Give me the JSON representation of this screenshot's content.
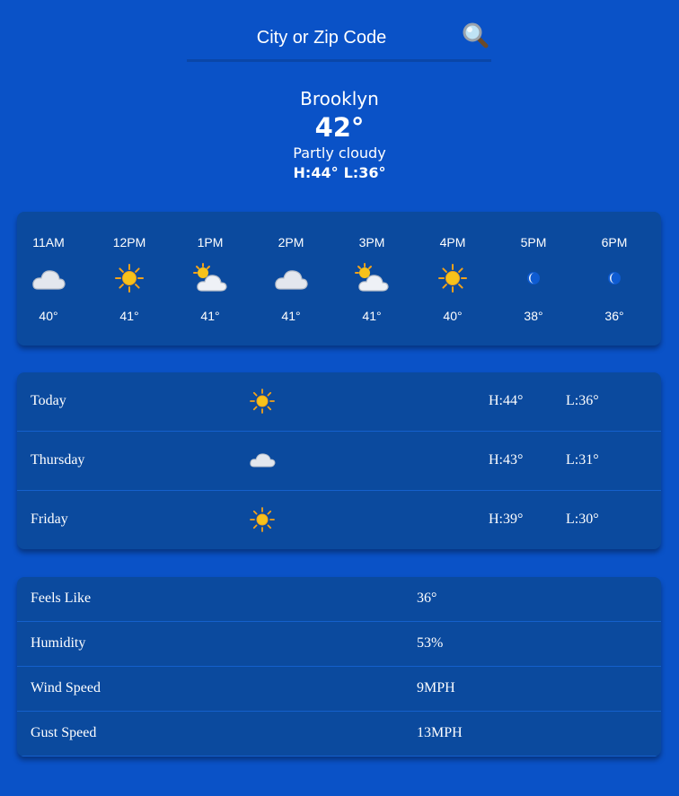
{
  "search": {
    "placeholder": "City or Zip Code",
    "icon": "magnifying-glass-icon"
  },
  "current": {
    "city": "Brooklyn",
    "temp": "42°",
    "condition": "Partly cloudy",
    "high": "H:44°",
    "low": "L:36°"
  },
  "hourly": [
    {
      "time": "11AM",
      "icon": "cloud-icon",
      "temp": "40°"
    },
    {
      "time": "12PM",
      "icon": "sun-icon",
      "temp": "41°"
    },
    {
      "time": "1PM",
      "icon": "sun-behind-cloud-icon",
      "temp": "41°"
    },
    {
      "time": "2PM",
      "icon": "cloud-icon",
      "temp": "41°"
    },
    {
      "time": "3PM",
      "icon": "sun-behind-cloud-icon",
      "temp": "41°"
    },
    {
      "time": "4PM",
      "icon": "sun-icon",
      "temp": "40°"
    },
    {
      "time": "5PM",
      "icon": "moon-icon",
      "temp": "38°"
    },
    {
      "time": "6PM",
      "icon": "moon-icon",
      "temp": "36°"
    }
  ],
  "daily": [
    {
      "day": "Today",
      "icon": "sun-icon",
      "high": "H:44°",
      "low": "L:36°"
    },
    {
      "day": "Thursday",
      "icon": "cloud-icon",
      "high": "H:43°",
      "low": "L:31°"
    },
    {
      "day": "Friday",
      "icon": "sun-icon",
      "high": "H:39°",
      "low": "L:30°"
    }
  ],
  "details": [
    {
      "label": "Feels Like",
      "value": "36°"
    },
    {
      "label": "Humidity",
      "value": "53%"
    },
    {
      "label": "Wind Speed",
      "value": "9MPH"
    },
    {
      "label": "Gust Speed",
      "value": "13MPH"
    }
  ],
  "colors": {
    "background": "#0a52c7",
    "card": "#0b4a9e",
    "sun": "#f7c21a",
    "cloud": "#e8ecf2"
  }
}
